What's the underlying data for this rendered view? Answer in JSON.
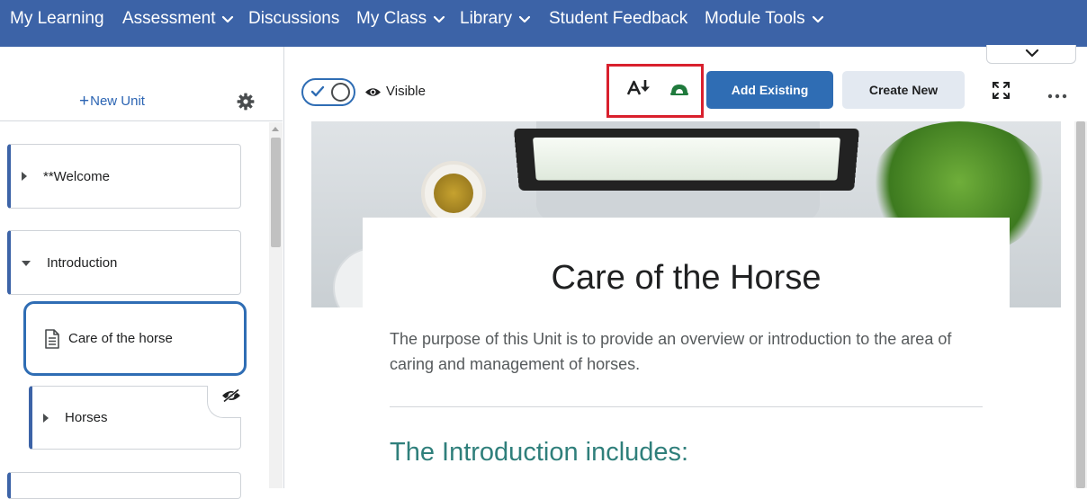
{
  "nav": {
    "items": [
      {
        "label": "My Learning",
        "dropdown": false
      },
      {
        "label": "Assessment",
        "dropdown": true
      },
      {
        "label": "Discussions",
        "dropdown": false
      },
      {
        "label": "My Class",
        "dropdown": true
      },
      {
        "label": "Library",
        "dropdown": true
      },
      {
        "label": "Student Feedback",
        "dropdown": false
      },
      {
        "label": "Module Tools",
        "dropdown": true
      }
    ],
    "background": "#3c63a7"
  },
  "sidebar": {
    "new_unit_plus": "+",
    "new_unit_label": "New Unit",
    "units": [
      {
        "label": "**Welcome",
        "expanded": false
      },
      {
        "label": "Introduction",
        "expanded": true
      }
    ],
    "selected_topic": {
      "label": "Care of the horse",
      "icon": "document-icon"
    },
    "sub_unit": {
      "label": "Horses",
      "expanded": false,
      "hidden": true
    }
  },
  "toolbar": {
    "visibility_label": "Visible",
    "visibility_on": true,
    "add_existing_label": "Add Existing",
    "create_new_label": "Create New",
    "accent": "#2f6db4",
    "highlight_color": "#d9202d"
  },
  "content": {
    "title": "Care of the Horse",
    "description": "The purpose of this Unit is to provide an overview or introduction to the area of caring and management of horses.",
    "subheading": "The Introduction includes:",
    "subheading_color": "#2f7f7b"
  }
}
